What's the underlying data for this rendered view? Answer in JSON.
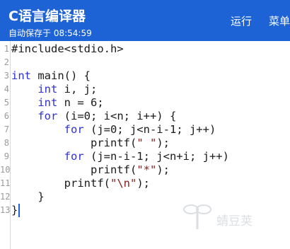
{
  "app": {
    "title": "C语言编译器",
    "autosave": "自动保存于 08:54:59",
    "actions": {
      "run": "运行",
      "menu": "菜单"
    }
  },
  "editor": {
    "lines": [
      {
        "n": "1",
        "code": "#include<stdio.h>"
      },
      {
        "n": "2",
        "code": ""
      },
      {
        "n": "3",
        "code": "int main() {"
      },
      {
        "n": "4",
        "code": "    int i, j;"
      },
      {
        "n": "5",
        "code": "    int n = 6;"
      },
      {
        "n": "6",
        "code": "    for (i=0; i<n; i++) {"
      },
      {
        "n": "7",
        "code": "        for (j=0; j<n-i-1; j++)"
      },
      {
        "n": "8",
        "code": "            printf(\" \");"
      },
      {
        "n": "9",
        "code": "        for (j=n-i-1; j<n+i; j++)"
      },
      {
        "n": "10",
        "code": "            printf(\"*\");"
      },
      {
        "n": "11",
        "code": "        printf(\"\\n\");"
      },
      {
        "n": "12",
        "code": "    }"
      },
      {
        "n": "13",
        "code": "}"
      }
    ]
  },
  "watermark": {
    "text": "蜻豆荚"
  },
  "colors": {
    "appbar": "#1e63d6",
    "keyword": "#2f2fd6",
    "string": "#8b1a1a"
  }
}
